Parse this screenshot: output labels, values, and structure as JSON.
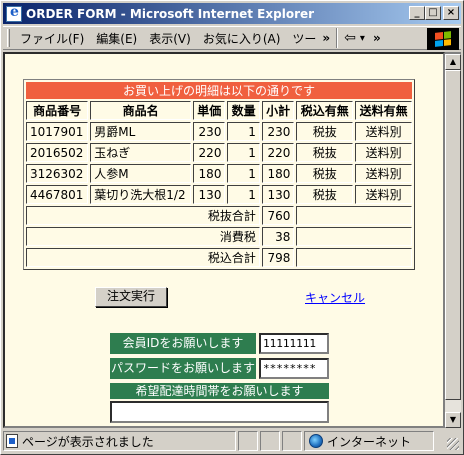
{
  "window": {
    "title": "ORDER FORM - Microsoft Internet Explorer",
    "min_glyph": "_",
    "max_glyph": "□",
    "close_glyph": "×"
  },
  "menu": {
    "items": [
      "ファイル(F)",
      "編集(E)",
      "表示(V)",
      "お気に入り(A)",
      "ツー"
    ],
    "overflow": "»",
    "back_glyph": "⇦",
    "back_dropdown": "▾",
    "toolbar_overflow": "»"
  },
  "order_table": {
    "caption": "お買い上げの明細は以下の通りです",
    "headers": [
      "商品番号",
      "商品名",
      "単価",
      "数量",
      "小計",
      "税込有無",
      "送料有無"
    ],
    "rows": [
      [
        "1017901",
        "男爵ML",
        "230",
        "1",
        "230",
        "税抜",
        "送料別"
      ],
      [
        "2016502",
        "玉ねぎ",
        "220",
        "1",
        "220",
        "税抜",
        "送料別"
      ],
      [
        "3126302",
        "人参M",
        "180",
        "1",
        "180",
        "税抜",
        "送料別"
      ],
      [
        "4467801",
        "葉切り洗大根1/2",
        "130",
        "1",
        "130",
        "税抜",
        "送料別"
      ]
    ],
    "summary": [
      {
        "label": "税抜合計",
        "value": "760"
      },
      {
        "label": "消費税",
        "value": "38"
      },
      {
        "label": "税込合計",
        "value": "798"
      }
    ]
  },
  "actions": {
    "submit_label": "注文実行",
    "cancel_label": "キャンセル"
  },
  "member": {
    "id_label": "会員IDをお願いします",
    "id_value": "11111111",
    "password_label": "パスワードをお願いします",
    "password_value": "********",
    "delivery_label": "希望配達時間帯をお願いします",
    "delivery_value": ""
  },
  "status": {
    "message": "ページが表示されました",
    "zone": "インターネット"
  },
  "colors": {
    "caption_bg": "#f0603f",
    "label_bg": "#2e7d4f",
    "page_bg": "#fffbe6",
    "link": "#0000ff"
  }
}
